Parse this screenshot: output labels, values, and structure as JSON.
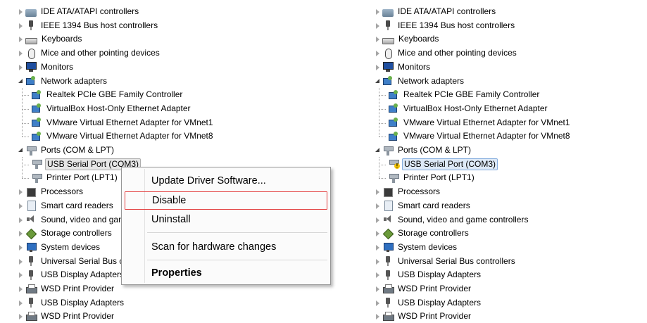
{
  "left_tree": {
    "items": [
      {
        "label": "IDE ATA/ATAPI controllers",
        "level": 0,
        "state": "collapsed",
        "icon": "ide-controller-icon"
      },
      {
        "label": "IEEE 1394 Bus host controllers",
        "level": 0,
        "state": "collapsed",
        "icon": "bus-controller-icon"
      },
      {
        "label": "Keyboards",
        "level": 0,
        "state": "collapsed",
        "icon": "keyboard-icon"
      },
      {
        "label": "Mice and other pointing devices",
        "level": 0,
        "state": "collapsed",
        "icon": "mouse-icon"
      },
      {
        "label": "Monitors",
        "level": 0,
        "state": "collapsed",
        "icon": "monitor-icon"
      },
      {
        "label": "Network adapters",
        "level": 0,
        "state": "expanded",
        "icon": "network-adapter-icon"
      },
      {
        "label": "Realtek PCIe GBE Family Controller",
        "level": 1,
        "icon": "network-adapter-icon"
      },
      {
        "label": "VirtualBox Host-Only Ethernet Adapter",
        "level": 1,
        "icon": "network-adapter-icon"
      },
      {
        "label": "VMware Virtual Ethernet Adapter for VMnet1",
        "level": 1,
        "icon": "network-adapter-icon"
      },
      {
        "label": "VMware Virtual Ethernet Adapter for VMnet8",
        "level": 1,
        "icon": "network-adapter-icon"
      },
      {
        "label": "Ports (COM & LPT)",
        "level": 0,
        "state": "expanded",
        "icon": "port-icon"
      },
      {
        "label": "USB Serial Port (COM3)",
        "level": 1,
        "icon": "port-icon",
        "hover": true
      },
      {
        "label": "Printer Port (LPT1)",
        "level": 1,
        "icon": "port-icon"
      },
      {
        "label": "Processors",
        "level": 0,
        "state": "collapsed",
        "icon": "processor-icon"
      },
      {
        "label": "Smart card readers",
        "level": 0,
        "state": "collapsed",
        "icon": "smart-card-icon"
      },
      {
        "label": "Sound, video and game controllers",
        "level": 0,
        "state": "collapsed",
        "icon": "sound-icon"
      },
      {
        "label": "Storage controllers",
        "level": 0,
        "state": "collapsed",
        "icon": "storage-icon"
      },
      {
        "label": "System devices",
        "level": 0,
        "state": "collapsed",
        "icon": "system-device-icon"
      },
      {
        "label": "Universal Serial Bus controllers",
        "level": 0,
        "state": "collapsed",
        "icon": "usb-icon"
      },
      {
        "label": "USB Display Adapters",
        "level": 0,
        "state": "collapsed",
        "icon": "usb-icon"
      },
      {
        "label": "WSD Print Provider",
        "level": 0,
        "state": "collapsed",
        "icon": "printer-icon"
      },
      {
        "label": "USB Display Adapters",
        "level": 0,
        "state": "collapsed",
        "icon": "usb-icon"
      },
      {
        "label": "WSD Print Provider",
        "level": 0,
        "state": "collapsed",
        "icon": "printer-icon"
      }
    ]
  },
  "right_tree": {
    "items": [
      {
        "label": "IDE ATA/ATAPI controllers",
        "level": 0,
        "state": "collapsed",
        "icon": "ide-controller-icon"
      },
      {
        "label": "IEEE 1394 Bus host controllers",
        "level": 0,
        "state": "collapsed",
        "icon": "bus-controller-icon"
      },
      {
        "label": "Keyboards",
        "level": 0,
        "state": "collapsed",
        "icon": "keyboard-icon"
      },
      {
        "label": "Mice and other pointing devices",
        "level": 0,
        "state": "collapsed",
        "icon": "mouse-icon"
      },
      {
        "label": "Monitors",
        "level": 0,
        "state": "collapsed",
        "icon": "monitor-icon"
      },
      {
        "label": "Network adapters",
        "level": 0,
        "state": "expanded",
        "icon": "network-adapter-icon"
      },
      {
        "label": "Realtek PCIe GBE Family Controller",
        "level": 1,
        "icon": "network-adapter-icon"
      },
      {
        "label": "VirtualBox Host-Only Ethernet Adapter",
        "level": 1,
        "icon": "network-adapter-icon"
      },
      {
        "label": "VMware Virtual Ethernet Adapter for VMnet1",
        "level": 1,
        "icon": "network-adapter-icon"
      },
      {
        "label": "VMware Virtual Ethernet Adapter for VMnet8",
        "level": 1,
        "icon": "network-adapter-icon"
      },
      {
        "label": "Ports (COM & LPT)",
        "level": 0,
        "state": "expanded",
        "icon": "port-icon"
      },
      {
        "label": "USB Serial Port (COM3)",
        "level": 1,
        "icon": "port-icon",
        "selected": true,
        "warning": true
      },
      {
        "label": "Printer Port (LPT1)",
        "level": 1,
        "icon": "port-icon"
      },
      {
        "label": "Processors",
        "level": 0,
        "state": "collapsed",
        "icon": "processor-icon"
      },
      {
        "label": "Smart card readers",
        "level": 0,
        "state": "collapsed",
        "icon": "smart-card-icon"
      },
      {
        "label": "Sound, video and game controllers",
        "level": 0,
        "state": "collapsed",
        "icon": "sound-icon"
      },
      {
        "label": "Storage controllers",
        "level": 0,
        "state": "collapsed",
        "icon": "storage-icon"
      },
      {
        "label": "System devices",
        "level": 0,
        "state": "collapsed",
        "icon": "system-device-icon"
      },
      {
        "label": "Universal Serial Bus controllers",
        "level": 0,
        "state": "collapsed",
        "icon": "usb-icon"
      },
      {
        "label": "USB Display Adapters",
        "level": 0,
        "state": "collapsed",
        "icon": "usb-icon"
      },
      {
        "label": "WSD Print Provider",
        "level": 0,
        "state": "collapsed",
        "icon": "printer-icon"
      },
      {
        "label": "USB Display Adapters",
        "level": 0,
        "state": "collapsed",
        "icon": "usb-icon"
      },
      {
        "label": "WSD Print Provider",
        "level": 0,
        "state": "collapsed",
        "icon": "printer-icon"
      }
    ]
  },
  "context_menu": {
    "update_driver": "Update Driver Software...",
    "disable": "Disable",
    "uninstall": "Uninstall",
    "scan": "Scan for hardware changes",
    "properties": "Properties"
  },
  "colors": {
    "highlight_border": "#e23b3b",
    "selection_fill": "#dde9f7",
    "selection_border": "#84acdd"
  }
}
